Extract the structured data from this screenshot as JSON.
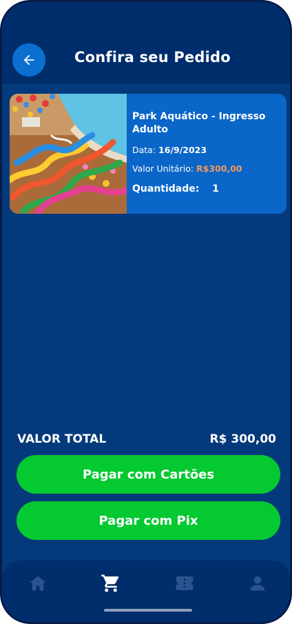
{
  "header": {
    "title": "Confira seu Pedido"
  },
  "order": {
    "product_name": "Park Aquático - Ingresso Adulto",
    "date_label": "Data:",
    "date_value": "16/9/2023",
    "unit_label": "Valor Unitário:",
    "unit_value": "R$300,00",
    "qty_label": "Quantidade:",
    "qty_value": "1"
  },
  "total": {
    "label": "VALOR TOTAL",
    "value": "R$ 300,00"
  },
  "actions": {
    "pay_cards": "Pagar com Cartões",
    "pay_pix": "Pagar com Pix"
  },
  "tabs": [
    {
      "icon": "home-icon",
      "active": false
    },
    {
      "icon": "cart-icon",
      "active": true
    },
    {
      "icon": "ticket-icon",
      "active": false
    },
    {
      "icon": "user-icon",
      "active": false
    }
  ],
  "colors": {
    "background": "#043a7b",
    "header": "#002d6c",
    "card": "#0a66c8",
    "accent_button": "#05c931",
    "price": "#f59a5b",
    "back_button": "#0b6fd0"
  }
}
